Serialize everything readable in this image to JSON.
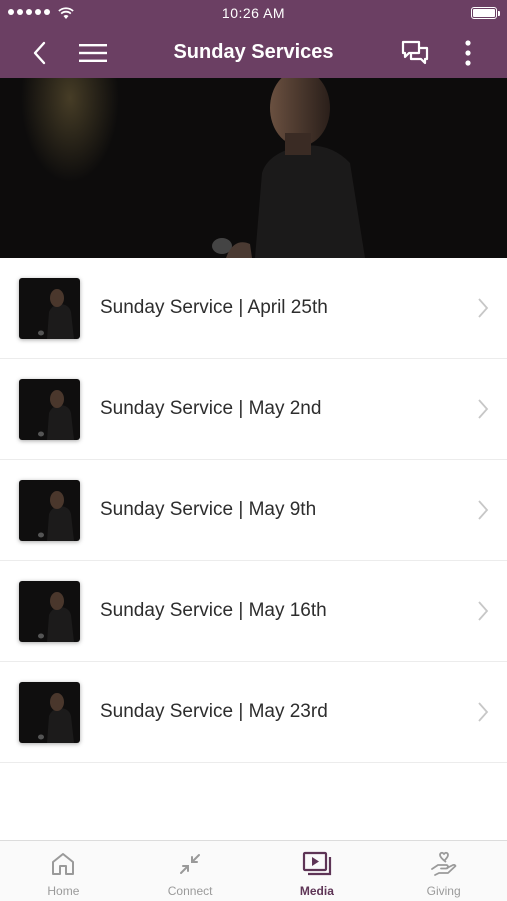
{
  "status_bar": {
    "time": "10:26 AM"
  },
  "header": {
    "title": "Sunday Services"
  },
  "colors": {
    "brand": "#6b3f63",
    "active_tab": "#5e3556",
    "inactive_tab": "#9a9a9a"
  },
  "icons": {
    "back": "chevron-left-icon",
    "menu": "hamburger-menu-icon",
    "chat": "chat-bubbles-icon",
    "more": "vertical-dots-icon",
    "row_chevron": "chevron-right-icon"
  },
  "services": [
    {
      "title": "Sunday Service | April 25th"
    },
    {
      "title": "Sunday Service | May 2nd"
    },
    {
      "title": "Sunday Service | May 9th"
    },
    {
      "title": "Sunday Service | May 16th"
    },
    {
      "title": "Sunday Service | May 23rd"
    }
  ],
  "tabs": [
    {
      "label": "Home",
      "icon": "home-icon",
      "active": false
    },
    {
      "label": "Connect",
      "icon": "connect-arrows-icon",
      "active": false
    },
    {
      "label": "Media",
      "icon": "media-play-icon",
      "active": true
    },
    {
      "label": "Giving",
      "icon": "giving-hand-heart-icon",
      "active": false
    }
  ]
}
